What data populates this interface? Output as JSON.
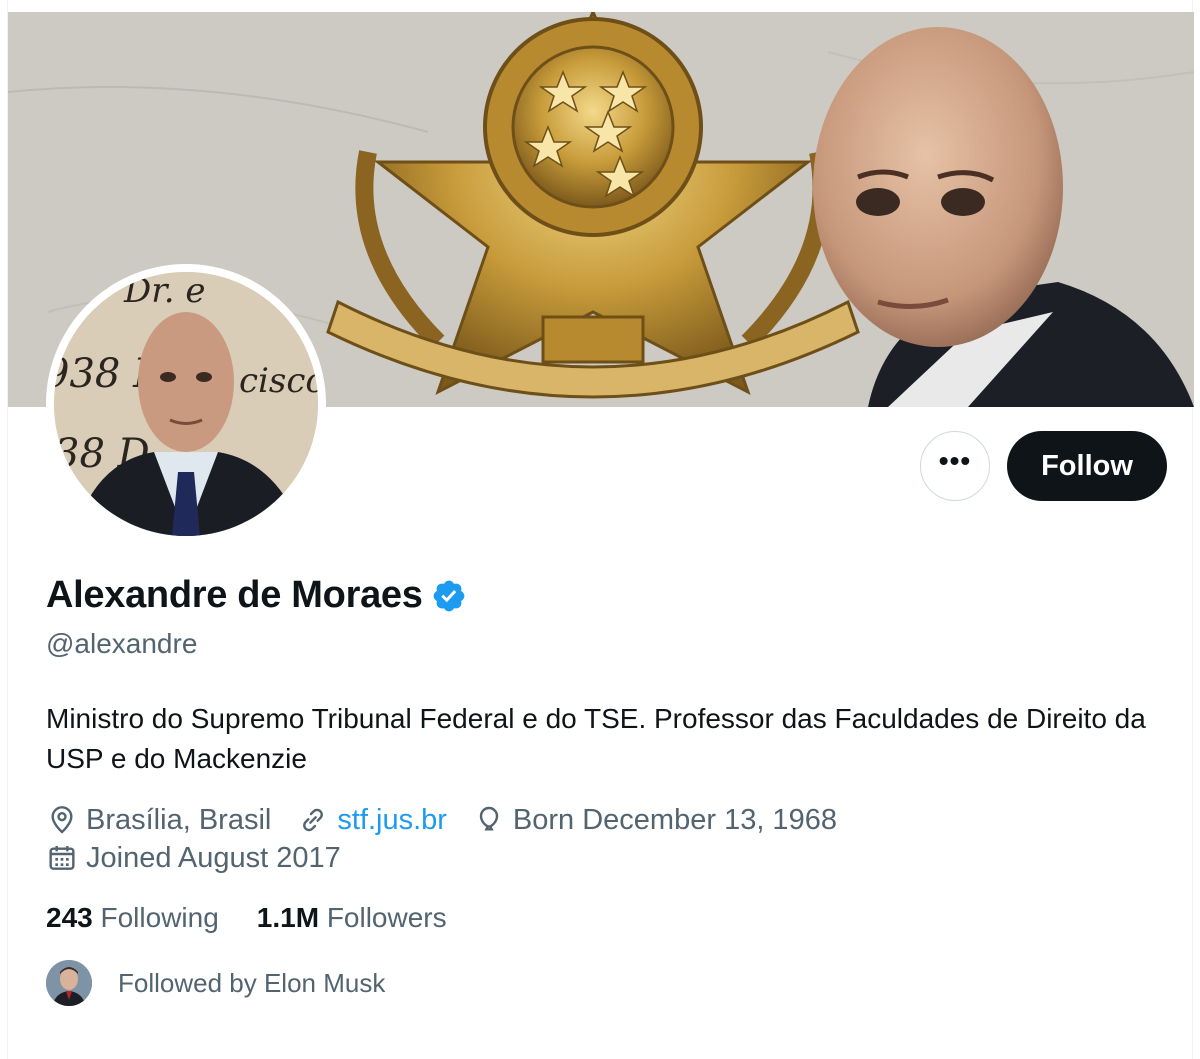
{
  "profile": {
    "display_name": "Alexandre de Moraes",
    "handle": "@alexandre",
    "verified": true,
    "bio": "Ministro do Supremo Tribunal Federal e do TSE. Professor das Faculdades de Direito da USP e do Mackenzie",
    "location": "Brasília, Brasil",
    "website": "stf.jus.br",
    "birthday": "Born December 13, 1968",
    "joined": "Joined August 2017"
  },
  "stats": {
    "following_count": "243",
    "following_label": "Following",
    "followers_count": "1.1M",
    "followers_label": "Followers"
  },
  "actions": {
    "follow_label": "Follow",
    "more_label": "•••"
  },
  "followed_by": {
    "text": "Followed by Elon Musk"
  },
  "colors": {
    "accent": "#1d9bf0",
    "text_primary": "#0f1419",
    "text_secondary": "#536471",
    "button_dark": "#0f1419"
  },
  "icons": {
    "location": "location-pin-icon",
    "website": "link-icon",
    "birthday": "balloon-icon",
    "joined": "calendar-icon",
    "verified": "verified-badge-icon",
    "more": "more-options-icon"
  }
}
